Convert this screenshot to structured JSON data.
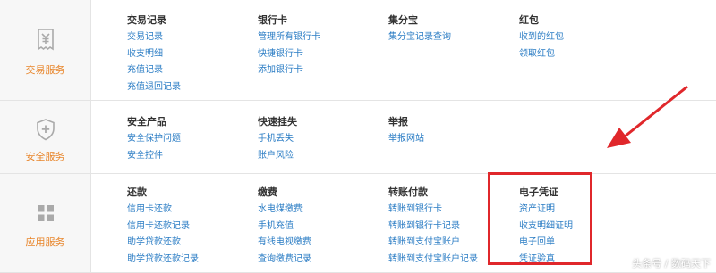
{
  "sections": [
    {
      "title": "交易服务",
      "columns": [
        {
          "heading": "交易记录",
          "links": [
            "交易记录",
            "收支明细",
            "充值记录",
            "充值退回记录"
          ]
        },
        {
          "heading": "银行卡",
          "links": [
            "管理所有银行卡",
            "快捷银行卡",
            "添加银行卡"
          ]
        },
        {
          "heading": "集分宝",
          "links": [
            "集分宝记录查询"
          ]
        },
        {
          "heading": "红包",
          "links": [
            "收到的红包",
            "领取红包"
          ]
        }
      ]
    },
    {
      "title": "安全服务",
      "columns": [
        {
          "heading": "安全产品",
          "links": [
            "安全保护问题",
            "安全控件"
          ]
        },
        {
          "heading": "快速挂失",
          "links": [
            "手机丢失",
            "账户风险"
          ]
        },
        {
          "heading": "举报",
          "links": [
            "举报网站"
          ]
        }
      ]
    },
    {
      "title": "应用服务",
      "columns": [
        {
          "heading": "还款",
          "links": [
            "信用卡还款",
            "信用卡还款记录",
            "助学贷款还款",
            "助学贷款还款记录"
          ]
        },
        {
          "heading": "缴费",
          "links": [
            "水电煤缴费",
            "手机充值",
            "有线电视缴费",
            "查询缴费记录"
          ]
        },
        {
          "heading": "转账付款",
          "links": [
            "转账到银行卡",
            "转账到银行卡记录",
            "转账到支付宝账户",
            "转账到支付宝账户记录"
          ]
        },
        {
          "heading": "电子凭证",
          "links": [
            "资产证明",
            "收支明细证明",
            "电子回单",
            "凭证验真"
          ]
        }
      ]
    }
  ],
  "colors": {
    "accent": "#e8852a",
    "link": "#2a7cc4",
    "annotation": "#e0272b"
  },
  "icons": [
    "receipt-yen-icon",
    "shield-plus-icon",
    "app-grid-icon"
  ],
  "watermark": "头条号 / 数码天下"
}
